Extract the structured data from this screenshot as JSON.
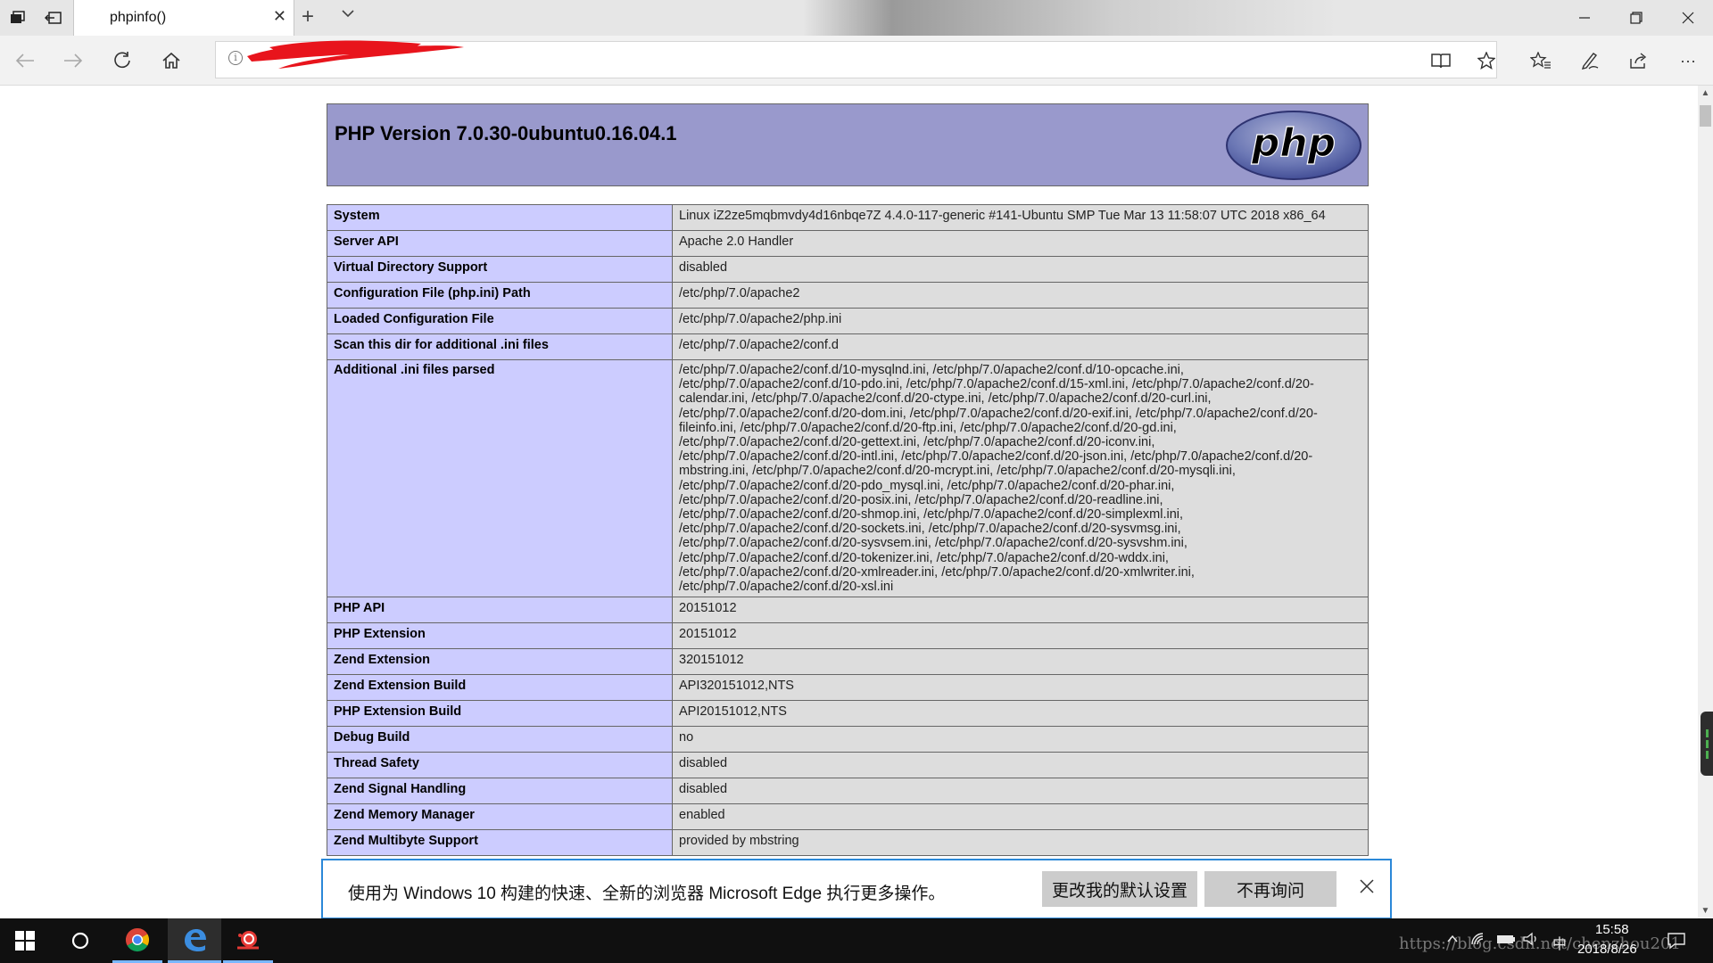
{
  "browser": {
    "tab_title": "phpinfo()",
    "window_controls": [
      "minimize-icon",
      "restore-icon",
      "close-icon"
    ],
    "nav_icons": [
      "back-icon",
      "forward-icon",
      "refresh-icon",
      "home-icon"
    ]
  },
  "php": {
    "version_title": "PHP Version 7.0.30-0ubuntu0.16.04.1",
    "logo_text": "php",
    "rows": [
      {
        "key": "System",
        "value": "Linux iZ2ze5mqbmvdy4d16nbqe7Z 4.4.0-117-generic #141-Ubuntu SMP Tue Mar 13 11:58:07 UTC 2018 x86_64"
      },
      {
        "key": "Server API",
        "value": "Apache 2.0 Handler"
      },
      {
        "key": "Virtual Directory Support",
        "value": "disabled"
      },
      {
        "key": "Configuration File (php.ini) Path",
        "value": "/etc/php/7.0/apache2"
      },
      {
        "key": "Loaded Configuration File",
        "value": "/etc/php/7.0/apache2/php.ini"
      },
      {
        "key": "Scan this dir for additional .ini files",
        "value": "/etc/php/7.0/apache2/conf.d"
      }
    ],
    "additional_ini": {
      "key": "Additional .ini files parsed",
      "lines": [
        "/etc/php/7.0/apache2/conf.d/10-mysqlnd.ini, /etc/php/7.0/apache2/conf.d/10-opcache.ini,",
        "/etc/php/7.0/apache2/conf.d/10-pdo.ini, /etc/php/7.0/apache2/conf.d/15-xml.ini, /etc/php/7.0/apache2/conf.d/20-",
        "calendar.ini, /etc/php/7.0/apache2/conf.d/20-ctype.ini, /etc/php/7.0/apache2/conf.d/20-curl.ini,",
        "/etc/php/7.0/apache2/conf.d/20-dom.ini, /etc/php/7.0/apache2/conf.d/20-exif.ini, /etc/php/7.0/apache2/conf.d/20-",
        "fileinfo.ini, /etc/php/7.0/apache2/conf.d/20-ftp.ini, /etc/php/7.0/apache2/conf.d/20-gd.ini,",
        "/etc/php/7.0/apache2/conf.d/20-gettext.ini, /etc/php/7.0/apache2/conf.d/20-iconv.ini,",
        "/etc/php/7.0/apache2/conf.d/20-intl.ini, /etc/php/7.0/apache2/conf.d/20-json.ini, /etc/php/7.0/apache2/conf.d/20-",
        "mbstring.ini, /etc/php/7.0/apache2/conf.d/20-mcrypt.ini, /etc/php/7.0/apache2/conf.d/20-mysqli.ini,",
        "/etc/php/7.0/apache2/conf.d/20-pdo_mysql.ini, /etc/php/7.0/apache2/conf.d/20-phar.ini,",
        "/etc/php/7.0/apache2/conf.d/20-posix.ini, /etc/php/7.0/apache2/conf.d/20-readline.ini,",
        "/etc/php/7.0/apache2/conf.d/20-shmop.ini, /etc/php/7.0/apache2/conf.d/20-simplexml.ini,",
        "/etc/php/7.0/apache2/conf.d/20-sockets.ini, /etc/php/7.0/apache2/conf.d/20-sysvmsg.ini,",
        "/etc/php/7.0/apache2/conf.d/20-sysvsem.ini, /etc/php/7.0/apache2/conf.d/20-sysvshm.ini,",
        "/etc/php/7.0/apache2/conf.d/20-tokenizer.ini, /etc/php/7.0/apache2/conf.d/20-wddx.ini,",
        "/etc/php/7.0/apache2/conf.d/20-xmlreader.ini, /etc/php/7.0/apache2/conf.d/20-xmlwriter.ini,",
        "/etc/php/7.0/apache2/conf.d/20-xsl.ini"
      ]
    },
    "rows_after": [
      {
        "key": "PHP API",
        "value": "20151012"
      },
      {
        "key": "PHP Extension",
        "value": "20151012"
      },
      {
        "key": "Zend Extension",
        "value": "320151012"
      },
      {
        "key": "Zend Extension Build",
        "value": "API320151012,NTS"
      },
      {
        "key": "PHP Extension Build",
        "value": "API20151012,NTS"
      },
      {
        "key": "Debug Build",
        "value": "no"
      },
      {
        "key": "Thread Safety",
        "value": "disabled"
      },
      {
        "key": "Zend Signal Handling",
        "value": "disabled"
      },
      {
        "key": "Zend Memory Manager",
        "value": "enabled"
      },
      {
        "key": "Zend Multibyte Support",
        "value": "provided by mbstring"
      }
    ]
  },
  "notification": {
    "message": "使用为 Windows 10 构建的快速、全新的浏览器 Microsoft Edge 执行更多操作。",
    "primary_button": "更改我的默认设置",
    "secondary_button": "不再询问"
  },
  "taskbar": {
    "time": "15:58",
    "date": "2018/8/26",
    "watermark": "https://blog.csdn.net/chenzhou201"
  },
  "colors": {
    "php_header_bg": "#9999cc",
    "table_key_bg": "#ccccff",
    "table_value_bg": "#dddddd",
    "notify_border": "#2b88d8",
    "taskbar_bg": "#101010"
  }
}
